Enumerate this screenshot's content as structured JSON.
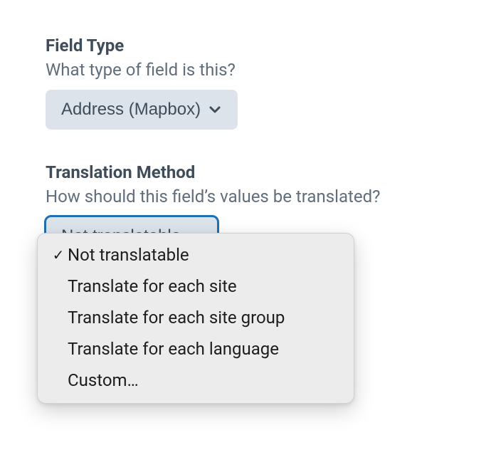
{
  "fieldType": {
    "label": "Field Type",
    "hint": "What type of field is this?",
    "value": "Address (Mapbox)"
  },
  "translationMethod": {
    "label": "Translation Method",
    "hint": "How should this field’s values be translated?",
    "value": "Not translatable",
    "options": [
      {
        "label": "Not translatable",
        "selected": true
      },
      {
        "label": "Translate for each site",
        "selected": false
      },
      {
        "label": "Translate for each site group",
        "selected": false
      },
      {
        "label": "Translate for each language",
        "selected": false
      },
      {
        "label": "Custom…",
        "selected": false
      }
    ]
  },
  "icons": {
    "check": "✓"
  }
}
